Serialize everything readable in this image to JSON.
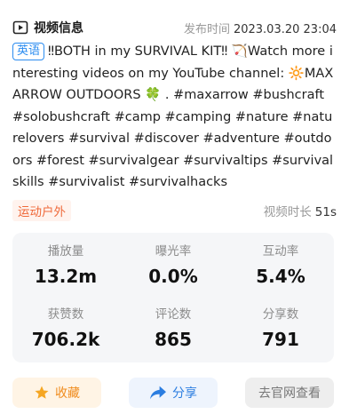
{
  "header": {
    "title": "视频信息",
    "publish_label": "发布时间",
    "publish_time": "2023.03.20 23:04"
  },
  "description": {
    "language_tag": "英语",
    "text": "‼BOTH in my SURVIVAL KIT‼ 🏹Watch more interesting videos on my YouTube channel: 🔆MAX ARROW OUTDOORS 🍀 . #maxarrow #bushcraft #solobushcraft #camp #camping #nature #naturelovers #survival #discover #adventure #outdoors #forest #survivalgear #survivaltips #survivalskills #survivalist #survivalhacks"
  },
  "meta": {
    "category": "运动户外",
    "duration_label": "视频时长",
    "duration_value": "51s"
  },
  "stats": {
    "plays_label": "播放量",
    "plays_value": "13.2m",
    "exposure_label": "曝光率",
    "exposure_value": "0.0%",
    "interaction_label": "互动率",
    "interaction_value": "5.4%",
    "likes_label": "获赞数",
    "likes_value": "706.2k",
    "comments_label": "评论数",
    "comments_value": "865",
    "shares_label": "分享数",
    "shares_value": "791"
  },
  "actions": {
    "favorite_label": "收藏",
    "share_label": "分享",
    "visit_label": "去官网查看"
  },
  "colors": {
    "accent_blue": "#2b8cf0",
    "category_orange": "#ef6a3b",
    "favorite_orange": "#f08c1e"
  }
}
